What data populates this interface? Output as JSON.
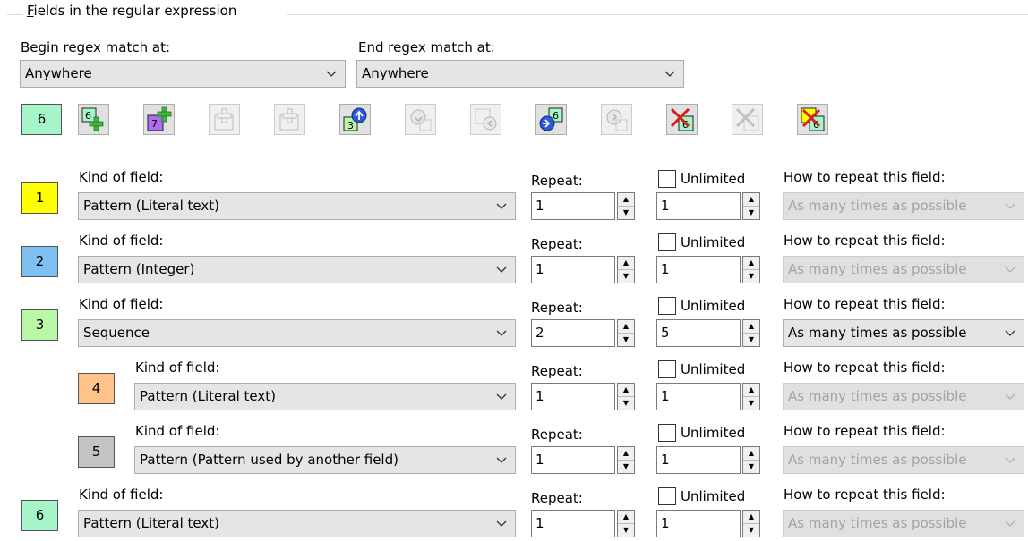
{
  "group": {
    "legend_prefix": "",
    "legend_accel": "F",
    "legend_rest": "ields in the regular expression"
  },
  "begin": {
    "label": "Begin regex match at:",
    "value": "Anywhere"
  },
  "end": {
    "label": "End regex match at:",
    "value": "Anywhere"
  },
  "toolbar": {
    "count_label": "6",
    "count_color": "#a6f5c8",
    "buttons": [
      {
        "name": "add-field-button",
        "icon": "add-field-icon",
        "badge": "6",
        "enabled": true
      },
      {
        "name": "add-subfield-button",
        "icon": "add-subfield-icon",
        "badge": "7",
        "enabled": true
      },
      {
        "name": "add-disabled-button-1",
        "icon": "plus-icon",
        "enabled": false
      },
      {
        "name": "add-disabled-button-2",
        "icon": "plus-icon",
        "enabled": false
      },
      {
        "name": "move-up-button",
        "icon": "move-up-icon",
        "badge": "3",
        "enabled": true
      },
      {
        "name": "move-down-button",
        "icon": "move-down-icon",
        "enabled": false
      },
      {
        "name": "move-left-button",
        "icon": "move-left-icon",
        "enabled": false
      },
      {
        "name": "move-right-button",
        "icon": "move-right-icon",
        "badge": "6",
        "enabled": true
      },
      {
        "name": "move-right-disabled-button",
        "icon": "move-right-icon",
        "enabled": false
      },
      {
        "name": "delete-field-button",
        "icon": "delete-icon",
        "badge": "6",
        "enabled": true
      },
      {
        "name": "delete-disabled-button",
        "icon": "delete-icon",
        "enabled": false
      },
      {
        "name": "delete-all-button",
        "icon": "delete-all-icon",
        "badge": "6",
        "enabled": true
      }
    ]
  },
  "labels": {
    "kind": "Kind of field:",
    "repeat": "Repeat:",
    "unlimited": "Unlimited",
    "how": "How to repeat this field:"
  },
  "fields": [
    {
      "num": "1",
      "color": "#ffff00",
      "kind": "Pattern (Literal text)",
      "repeat_min": "1",
      "repeat_max": "1",
      "unlimited": false,
      "how": "As many times as possible",
      "how_enabled": false,
      "indent": 0
    },
    {
      "num": "2",
      "color": "#7ec0f2",
      "kind": "Pattern (Integer)",
      "repeat_min": "1",
      "repeat_max": "1",
      "unlimited": false,
      "how": "As many times as possible",
      "how_enabled": false,
      "indent": 0
    },
    {
      "num": "3",
      "color": "#b9f7a6",
      "kind": "Sequence",
      "repeat_min": "2",
      "repeat_max": "5",
      "unlimited": false,
      "how": "As many times as possible",
      "how_enabled": true,
      "indent": 0
    },
    {
      "num": "4",
      "color": "#ffc38a",
      "kind": "Pattern (Literal text)",
      "repeat_min": "1",
      "repeat_max": "1",
      "unlimited": false,
      "how": "As many times as possible",
      "how_enabled": false,
      "indent": 1
    },
    {
      "num": "5",
      "color": "#c3c3c3",
      "kind": "Pattern (Pattern used by another field)",
      "repeat_min": "1",
      "repeat_max": "1",
      "unlimited": false,
      "how": "As many times as possible",
      "how_enabled": false,
      "indent": 1
    },
    {
      "num": "6",
      "color": "#a6f5c8",
      "kind": "Pattern (Literal text)",
      "repeat_min": "1",
      "repeat_max": "1",
      "unlimited": false,
      "how": "As many times as possible",
      "how_enabled": false,
      "indent": 0
    }
  ]
}
